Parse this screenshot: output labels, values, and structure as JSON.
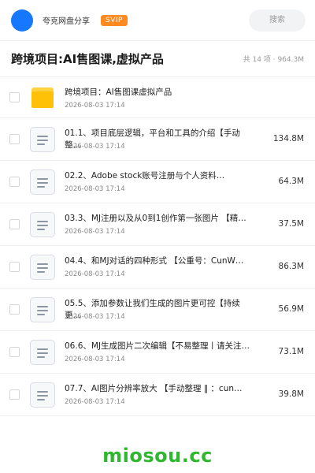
{
  "header": {
    "brand": "夸克网盘分享",
    "badge": "SVIP",
    "search_placeholder": "搜索"
  },
  "folder": {
    "title": "跨境项目:AI售图课,虚拟产品",
    "summary": "共 14 项 · 964.3M"
  },
  "files": [
    {
      "icon": "folder-icon",
      "name": "跨境项目：AI售图课虚拟产品",
      "date": "2026-08-03 17:14",
      "size": ""
    },
    {
      "icon": "document-icon",
      "name": "01.1、项目底层逻辑，平台和工具的介绍【手动整…",
      "date": "2026-08-03 17:14",
      "size": "134.8M"
    },
    {
      "icon": "document-icon",
      "name": "02.2、Adobe stock账号注册与个人资料…",
      "date": "2026-08-03 17:14",
      "size": "64.3M"
    },
    {
      "icon": "document-icon",
      "name": "03.3、MJ注册以及从0到1创作第一张图片 【精…",
      "date": "2026-08-03 17:14",
      "size": "37.5M"
    },
    {
      "icon": "document-icon",
      "name": "04.4、和MJ对话的四种形式 【公重号：CunW…",
      "date": "2026-08-03 17:14",
      "size": "86.3M"
    },
    {
      "icon": "document-icon",
      "name": "05.5、添加参数让我们生成的图片更可控【持续更…",
      "date": "2026-08-03 17:14",
      "size": "56.9M"
    },
    {
      "icon": "document-icon",
      "name": "06.6、MJ生成图片二次编辑【不易整理丨请关注…",
      "date": "2026-08-03 17:14",
      "size": "73.1M"
    },
    {
      "icon": "document-icon",
      "name": "07.7、AI图片分辨率放大 【手动整理 ‖ ：cun…",
      "date": "2026-08-03 17:14",
      "size": "39.8M"
    }
  ],
  "watermark": "miosou.cc",
  "colors": {
    "accent": "#1677ff",
    "svip": "#ff8a1f",
    "folder": "#ffc107",
    "watermark": "#2eb82e"
  }
}
